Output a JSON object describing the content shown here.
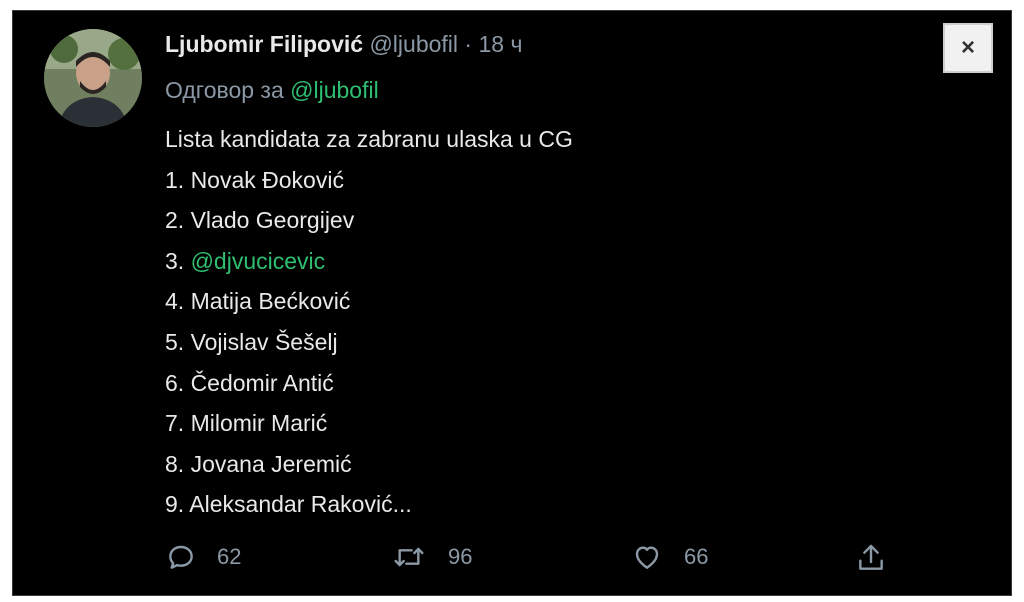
{
  "tweet": {
    "author_name": "Ljubomir Filipović",
    "handle": "@ljubofil",
    "separator": "·",
    "time": "18 ч",
    "reply_prefix": "Одговор за ",
    "reply_to": "@ljubofil",
    "lines": [
      "Lista kandidata za zabranu ulaska u CG",
      "1. Novak Đoković",
      "2. Vlado Georgijev",
      "3. ",
      "4. Matija Bećković",
      "5. Vojislav Šešelj",
      "6. Čedomir Antić",
      "7. Milomir Marić",
      "8. Jovana Jeremić",
      "9. Aleksandar Raković..."
    ],
    "line3_mention": "@djvucicevic"
  },
  "actions": {
    "reply_count": "62",
    "retweet_count": "96",
    "like_count": "66"
  },
  "close_label": "×",
  "colors": {
    "background": "#000000",
    "text": "#e7e9ea",
    "muted": "#8b98a5",
    "mention": "#2fbf71"
  }
}
